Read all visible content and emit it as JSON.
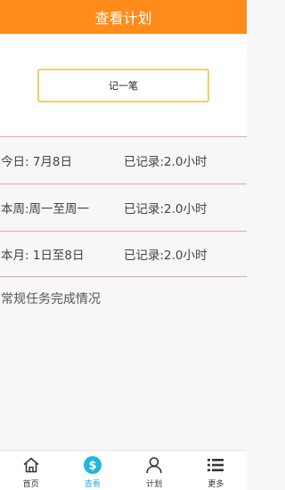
{
  "header": {
    "title": "查看计划"
  },
  "record_button": {
    "label": "记一笔"
  },
  "stats": [
    {
      "period": "今日: 7月8日",
      "recorded": "已记录:2.0小时"
    },
    {
      "period": "本周:周一至周一",
      "recorded": "已记录:2.0小时"
    },
    {
      "period": "本月: 1日至8日",
      "recorded": "已记录:2.0小时"
    }
  ],
  "section_title": "常规任务完成情况",
  "tabbar": {
    "tabs": [
      {
        "label": "首页",
        "icon": "home-icon"
      },
      {
        "label": "查看",
        "icon": "coin-icon",
        "active": true
      },
      {
        "label": "计划",
        "icon": "user-icon"
      },
      {
        "label": "更多",
        "icon": "list-icon"
      }
    ]
  },
  "colors": {
    "header_bg": "#ff8c1a",
    "button_border": "#f0ce6c",
    "divider": "#e7a3ac",
    "active_tab": "#22b7dd"
  }
}
